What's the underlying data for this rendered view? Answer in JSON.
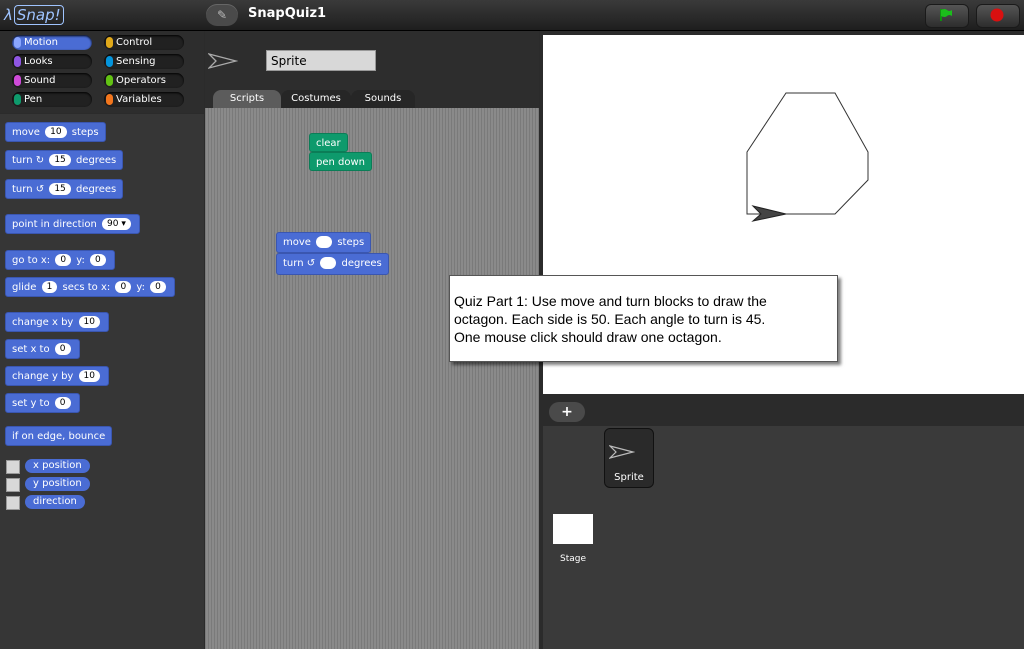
{
  "app": {
    "logo_lambda": "λ",
    "logo_text": "Snap!",
    "project_name": "SnapQuiz1"
  },
  "categories": [
    {
      "label": "Motion",
      "color": "#4a6cd4",
      "selected": true
    },
    {
      "label": "Control",
      "color": "#e1a91a"
    },
    {
      "label": "Looks",
      "color": "#8f56e3"
    },
    {
      "label": "Sensing",
      "color": "#0494dc"
    },
    {
      "label": "Sound",
      "color": "#cf4ad9"
    },
    {
      "label": "Operators",
      "color": "#62c213"
    },
    {
      "label": "Pen",
      "color": "#0e9a6c"
    },
    {
      "label": "Variables",
      "color": "#f3761d"
    }
  ],
  "palette": {
    "move": {
      "a": "move",
      "v": "10",
      "b": "steps"
    },
    "turn_cw": {
      "a": "turn",
      "icon": "↻",
      "v": "15",
      "b": "degrees"
    },
    "turn_ccw": {
      "a": "turn",
      "icon": "↺",
      "v": "15",
      "b": "degrees"
    },
    "point": {
      "a": "point in direction",
      "v": "90"
    },
    "goto": {
      "a": "go to x:",
      "x": "0",
      "ylab": "y:",
      "y": "0"
    },
    "glide": {
      "a": "glide",
      "v": "1",
      "b": "secs to x:",
      "x": "0",
      "ylab": "y:",
      "y": "0"
    },
    "change_x": {
      "a": "change x by",
      "v": "10"
    },
    "set_x": {
      "a": "set x to",
      "v": "0"
    },
    "change_y": {
      "a": "change y by",
      "v": "10"
    },
    "set_y": {
      "a": "set y to",
      "v": "0"
    },
    "bounce": {
      "a": "if on edge, bounce"
    },
    "reporters": [
      "x position",
      "y position",
      "direction"
    ]
  },
  "sprite": {
    "name": "Sprite"
  },
  "tabs": [
    "Scripts",
    "Costumes",
    "Sounds"
  ],
  "script": {
    "clear": "clear",
    "pen_down": "pen down",
    "move_a": "move",
    "move_b": "steps",
    "turn_a": "turn",
    "turn_icon": "↺",
    "turn_b": "degrees"
  },
  "quiz": {
    "line1": "Quiz Part 1:  Use move and turn blocks to draw the",
    "line2": "octagon.  Each side is 50.  Each angle to turn is 45.",
    "line3": "One mouse click should draw one octagon."
  },
  "corral": {
    "add": "+",
    "sprite_label": "Sprite",
    "stage_label": "Stage"
  }
}
